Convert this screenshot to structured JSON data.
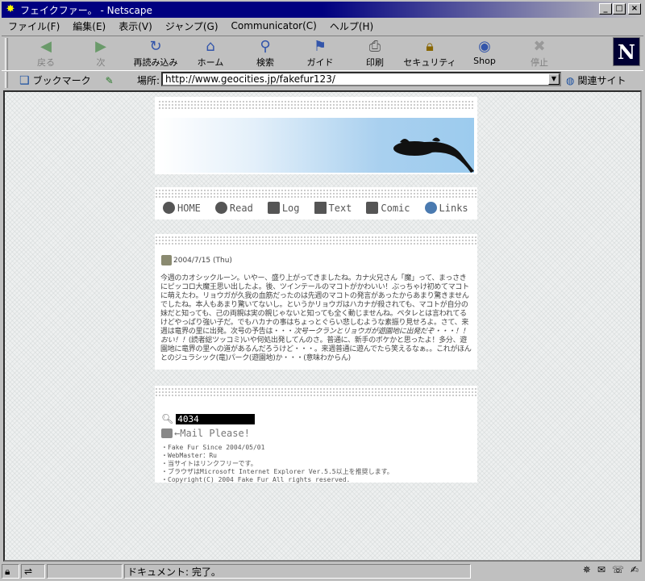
{
  "window": {
    "title": "フェイクファー。 - Netscape",
    "controls": [
      "_",
      "□",
      "×"
    ]
  },
  "menu": [
    "ファイル(F)",
    "編集(E)",
    "表示(V)",
    "ジャンプ(G)",
    "Communicator(C)",
    "ヘルプ(H)"
  ],
  "toolbar": {
    "back": "戻る",
    "forward": "次",
    "reload": "再読み込み",
    "home": "ホーム",
    "search": "検索",
    "guide": "ガイド",
    "print": "印刷",
    "security": "セキュリティ",
    "shop": "Shop",
    "stop": "停止"
  },
  "location": {
    "bookmarks": "ブックマーク",
    "label": "場所:",
    "url": "http://www.geocities.jp/fakefur123/",
    "related": "関連サイト"
  },
  "nav": [
    "HOME",
    "Read",
    "Log",
    "Text",
    "Comic",
    "Links"
  ],
  "post": {
    "date": "2004/7/15 (Thu)",
    "body": "今週のカオシックルーン。いやー、盛り上がってきましたね。カナ火兄さん「魔」って、まっさきにピッコロ大魔王思い出したよ。後、ツインテールのマコトがかわいい！ぶっちゃけ初めてマコトに萌えたわ。リョウガが久我の血筋だったのは先週のマコトの発言があったからあまり驚きませんでしたね。本人もあまり驚いてないし。というかリョウガはハカナが殺されても、マコトが自分の妹だと知っても、己の両親は実の親じゃないと知っても全く動じませんね。ペタレとは言われてるけどやっぱり強い子だ。でもハカナの事はちょっとぐらい悲しむような素振り見せろよ。さて、来週は竜界の里に出発。次号の予告は・・・",
    "body_em": "次号ークランとリョウガが遊園地に出発だぞ・・・！！おい！！",
    "body_tail": "(読者総ツッコミ)いや何処出発してんのさ。普通に、新手のボケかと思ったよ！多分、遊園地に竜界の里への道があるんだろうけど・・・。来週普通に遊んでたら笑えるなぁ。。これがほんとのジュラシック(竜)パーク(遊園地)か・・・(意味わからん)"
  },
  "info": {
    "counter": "4034",
    "mail": "←Mail Please!",
    "notes": [
      "・Fake Fur Since 2004/05/01",
      "・WebMaster：Ru",
      "・当サイトはリンクフリーです。",
      "・ブラウザはMicrosoft Internet Explorer Ver.5.5以上を推奨します。",
      "・Copyright(C) 2004 Fake Fur All rights reserved."
    ]
  },
  "status": {
    "text": "ドキュメント: 完了。"
  },
  "colors": {
    "title_active": "#000080",
    "chrome": "#c0c0c0",
    "page_bg": "#eef0f0"
  }
}
